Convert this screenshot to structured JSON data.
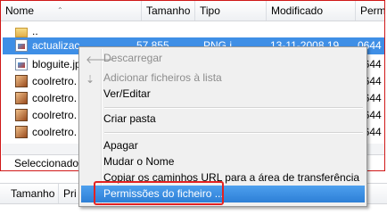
{
  "file_list": {
    "columns": [
      "Nome",
      "Tamanho",
      "Tipo",
      "Modificado",
      "Perm"
    ],
    "rows": [
      {
        "name": "..",
        "size": "",
        "type": "",
        "modified": "",
        "perm": "",
        "icon": "folder-icon"
      },
      {
        "name": "actualizac",
        "size": "57 855",
        "type": "PNG i",
        "modified": "13-11-2008 19",
        "perm": "0644",
        "icon": "image-file-icon",
        "selected": true
      },
      {
        "name": "bloguite.jp",
        "size": "",
        "type": "",
        "modified": "",
        "perm": "0644",
        "icon": "image-file-icon"
      },
      {
        "name": "coolretro.",
        "size": "",
        "type": "",
        "modified": "",
        "perm": "0644",
        "icon": "image-file-icon"
      },
      {
        "name": "coolretro.",
        "size": "",
        "type": "",
        "modified": "",
        "perm": "0644",
        "icon": "image-file-icon"
      },
      {
        "name": "coolretro.",
        "size": "",
        "type": "",
        "modified": "",
        "perm": "0644",
        "icon": "image-file-icon"
      },
      {
        "name": "coolretro.",
        "size": "",
        "type": "",
        "modified": "",
        "perm": "0644",
        "icon": "image-file-icon"
      }
    ]
  },
  "status": {
    "text": "Seleccionado"
  },
  "queue": {
    "columns": [
      "Tamanho",
      "Pri"
    ]
  },
  "context_menu": {
    "items": [
      {
        "label": "Descarregar",
        "disabled": true,
        "icon": "download-arrow-icon"
      },
      {
        "label": "Adicionar ficheiros à lista",
        "disabled": true,
        "icon": "add-to-queue-icon"
      },
      {
        "label": "Ver/Editar",
        "disabled": false
      },
      {
        "label": "Criar pasta",
        "disabled": false
      },
      {
        "label": "Apagar",
        "disabled": false
      },
      {
        "label": "Mudar o Nome",
        "disabled": false
      },
      {
        "label": "Copiar os caminhos URL para a área de transferência",
        "disabled": false
      },
      {
        "label": "Permissões do ficheiro ...",
        "disabled": false,
        "highlighted": true
      }
    ]
  },
  "colors": {
    "selection": "#3f8fe6",
    "highlight_box": "#e32222"
  }
}
